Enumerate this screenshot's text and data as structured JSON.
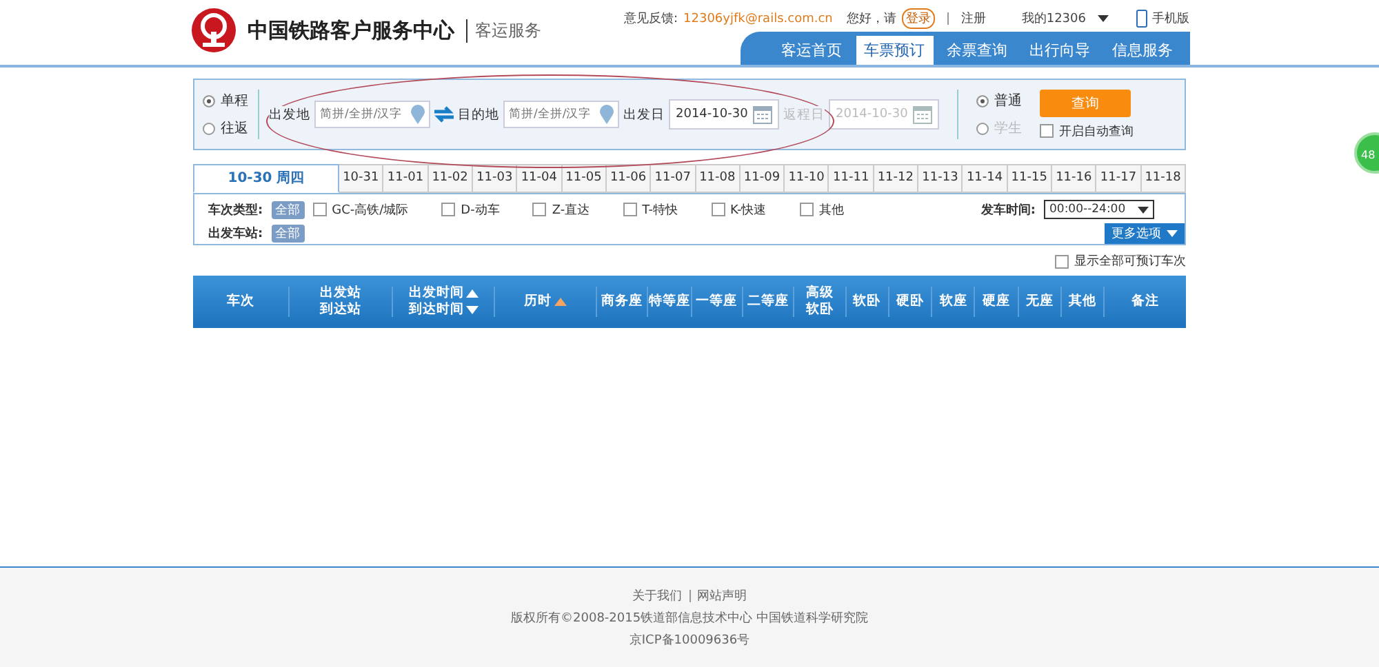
{
  "header": {
    "site_name": "中国铁路客户服务中心",
    "section": "客运服务",
    "feedback_label": "意见反馈:",
    "feedback_email": "12306yjfk@rails.com.cn",
    "greeting": "您好，请",
    "login": "登录",
    "register": "注册",
    "my_account": "我的12306",
    "mobile": "手机版"
  },
  "nav": [
    {
      "label": "客运首页",
      "selected": false
    },
    {
      "label": "车票预订",
      "selected": true
    },
    {
      "label": "余票查询",
      "selected": false
    },
    {
      "label": "出行向导",
      "selected": false
    },
    {
      "label": "信息服务",
      "selected": false
    }
  ],
  "search": {
    "trip_types": [
      {
        "label": "单程",
        "selected": true
      },
      {
        "label": "往返",
        "selected": false
      }
    ],
    "from_label": "出发地",
    "from_placeholder": "简拼/全拼/汉字",
    "to_label": "目的地",
    "to_placeholder": "简拼/全拼/汉字",
    "date_label": "出发日",
    "date_value": "2014-10-30",
    "return_label": "返程日",
    "return_value": "2014-10-30",
    "return_disabled": true,
    "ticket_types": [
      {
        "label": "普通",
        "selected": true,
        "disabled": false
      },
      {
        "label": "学生",
        "selected": false,
        "disabled": true
      }
    ],
    "query_button": "查询",
    "auto_query": {
      "label": "开启自动查询",
      "checked": false
    }
  },
  "dates": [
    {
      "label": "10-30 周四",
      "selected": true
    },
    {
      "label": "10-31",
      "selected": false
    },
    {
      "label": "11-01",
      "selected": false
    },
    {
      "label": "11-02",
      "selected": false
    },
    {
      "label": "11-03",
      "selected": false
    },
    {
      "label": "11-04",
      "selected": false
    },
    {
      "label": "11-05",
      "selected": false
    },
    {
      "label": "11-06",
      "selected": false
    },
    {
      "label": "11-07",
      "selected": false
    },
    {
      "label": "11-08",
      "selected": false
    },
    {
      "label": "11-09",
      "selected": false
    },
    {
      "label": "11-10",
      "selected": false
    },
    {
      "label": "11-11",
      "selected": false
    },
    {
      "label": "11-12",
      "selected": false
    },
    {
      "label": "11-13",
      "selected": false
    },
    {
      "label": "11-14",
      "selected": false
    },
    {
      "label": "11-15",
      "selected": false
    },
    {
      "label": "11-16",
      "selected": false
    },
    {
      "label": "11-17",
      "selected": false
    },
    {
      "label": "11-18",
      "selected": false
    }
  ],
  "filters": {
    "train_type_label": "车次类型:",
    "all_label": "全部",
    "train_types": [
      {
        "label": "GC-高铁/城际",
        "checked": false
      },
      {
        "label": "D-动车",
        "checked": false
      },
      {
        "label": "Z-直达",
        "checked": false
      },
      {
        "label": "T-特快",
        "checked": false
      },
      {
        "label": "K-快速",
        "checked": false
      },
      {
        "label": "其他",
        "checked": false
      }
    ],
    "departure_time_label": "发车时间:",
    "departure_time_value": "00:00--24:00",
    "station_label": "出发车站:",
    "station_all": "全部",
    "more_options": "更多选项",
    "show_all": {
      "label": "显示全部可预订车次",
      "checked": false
    }
  },
  "table": {
    "columns": [
      {
        "lines": [
          "车次"
        ]
      },
      {
        "lines": [
          "出发站",
          "到达站"
        ]
      },
      {
        "lines": [
          "出发时间",
          "到达时间"
        ],
        "kind": "sortable"
      },
      {
        "lines": [
          "历时"
        ],
        "kind": "sorted"
      },
      {
        "lines": [
          "商务座"
        ]
      },
      {
        "lines": [
          "特等座"
        ]
      },
      {
        "lines": [
          "一等座"
        ]
      },
      {
        "lines": [
          "二等座"
        ]
      },
      {
        "lines": [
          "高级",
          "软卧"
        ]
      },
      {
        "lines": [
          "软卧"
        ]
      },
      {
        "lines": [
          "硬卧"
        ]
      },
      {
        "lines": [
          "软座"
        ]
      },
      {
        "lines": [
          "硬座"
        ]
      },
      {
        "lines": [
          "无座"
        ]
      },
      {
        "lines": [
          "其他"
        ]
      },
      {
        "lines": [
          "备注"
        ]
      }
    ]
  },
  "footer": {
    "links": [
      "关于我们",
      "网站声明"
    ],
    "copyright": "版权所有©2008-2015铁道部信息技术中心   中国铁道科学研究院",
    "icp": "京ICP备10009636号"
  },
  "side_badge": "48"
}
